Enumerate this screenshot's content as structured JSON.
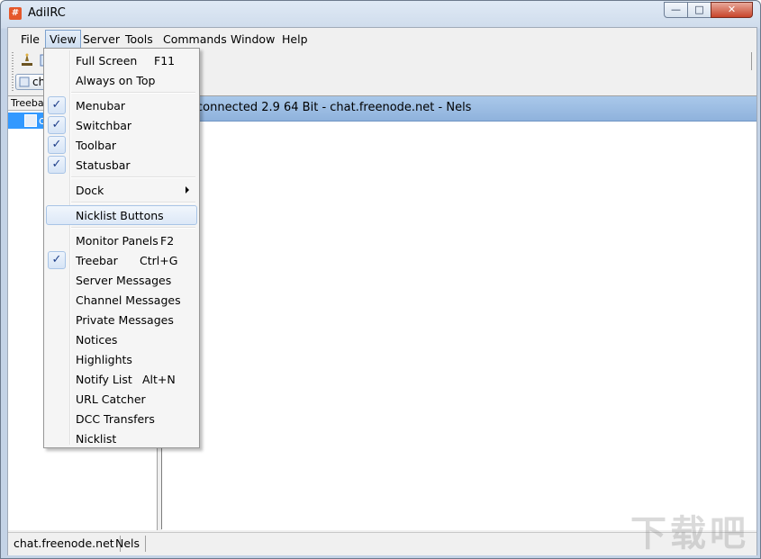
{
  "window": {
    "title": "AdiIRC",
    "icon_text": "#"
  },
  "menubar": {
    "items": [
      "File",
      "View",
      "Server",
      "Tools",
      "Commands",
      "Window",
      "Help"
    ]
  },
  "switchbar": {
    "button_label": "ch"
  },
  "treebar": {
    "header": "Treebar",
    "selected_item": "c"
  },
  "chat": {
    "header_text": "connected 2.9 64 Bit - chat.freenode.net - Nels"
  },
  "statusbar": {
    "server": "chat.freenode.net",
    "nick": "Nels"
  },
  "view_menu": {
    "items": [
      {
        "label": "Full Screen",
        "shortcut": "F11",
        "checked": false
      },
      {
        "label": "Always on Top",
        "shortcut": "",
        "checked": false
      },
      {
        "label": "Menubar",
        "shortcut": "",
        "checked": true
      },
      {
        "label": "Switchbar",
        "shortcut": "",
        "checked": true
      },
      {
        "label": "Toolbar",
        "shortcut": "",
        "checked": true
      },
      {
        "label": "Statusbar",
        "shortcut": "",
        "checked": true
      },
      {
        "label": "Dock",
        "shortcut": "",
        "checked": false,
        "submenu": true
      },
      {
        "label": "Nicklist Buttons",
        "shortcut": "",
        "checked": false,
        "highlighted": true
      },
      {
        "label": "Monitor Panels",
        "shortcut": "F2",
        "checked": false
      },
      {
        "label": "Treebar",
        "shortcut": "Ctrl+G",
        "checked": true
      },
      {
        "label": "Server Messages",
        "shortcut": "",
        "checked": false
      },
      {
        "label": "Channel Messages",
        "shortcut": "",
        "checked": false
      },
      {
        "label": "Private Messages",
        "shortcut": "",
        "checked": false
      },
      {
        "label": "Notices",
        "shortcut": "",
        "checked": false
      },
      {
        "label": "Highlights",
        "shortcut": "",
        "checked": false
      },
      {
        "label": "Notify List",
        "shortcut": "Alt+N",
        "checked": false
      },
      {
        "label": "URL Catcher",
        "shortcut": "",
        "checked": false
      },
      {
        "label": "DCC Transfers",
        "shortcut": "",
        "checked": false
      },
      {
        "label": "Nicklist",
        "shortcut": "",
        "checked": false
      }
    ],
    "check_glyph": "✓"
  },
  "watermark": "下载吧"
}
